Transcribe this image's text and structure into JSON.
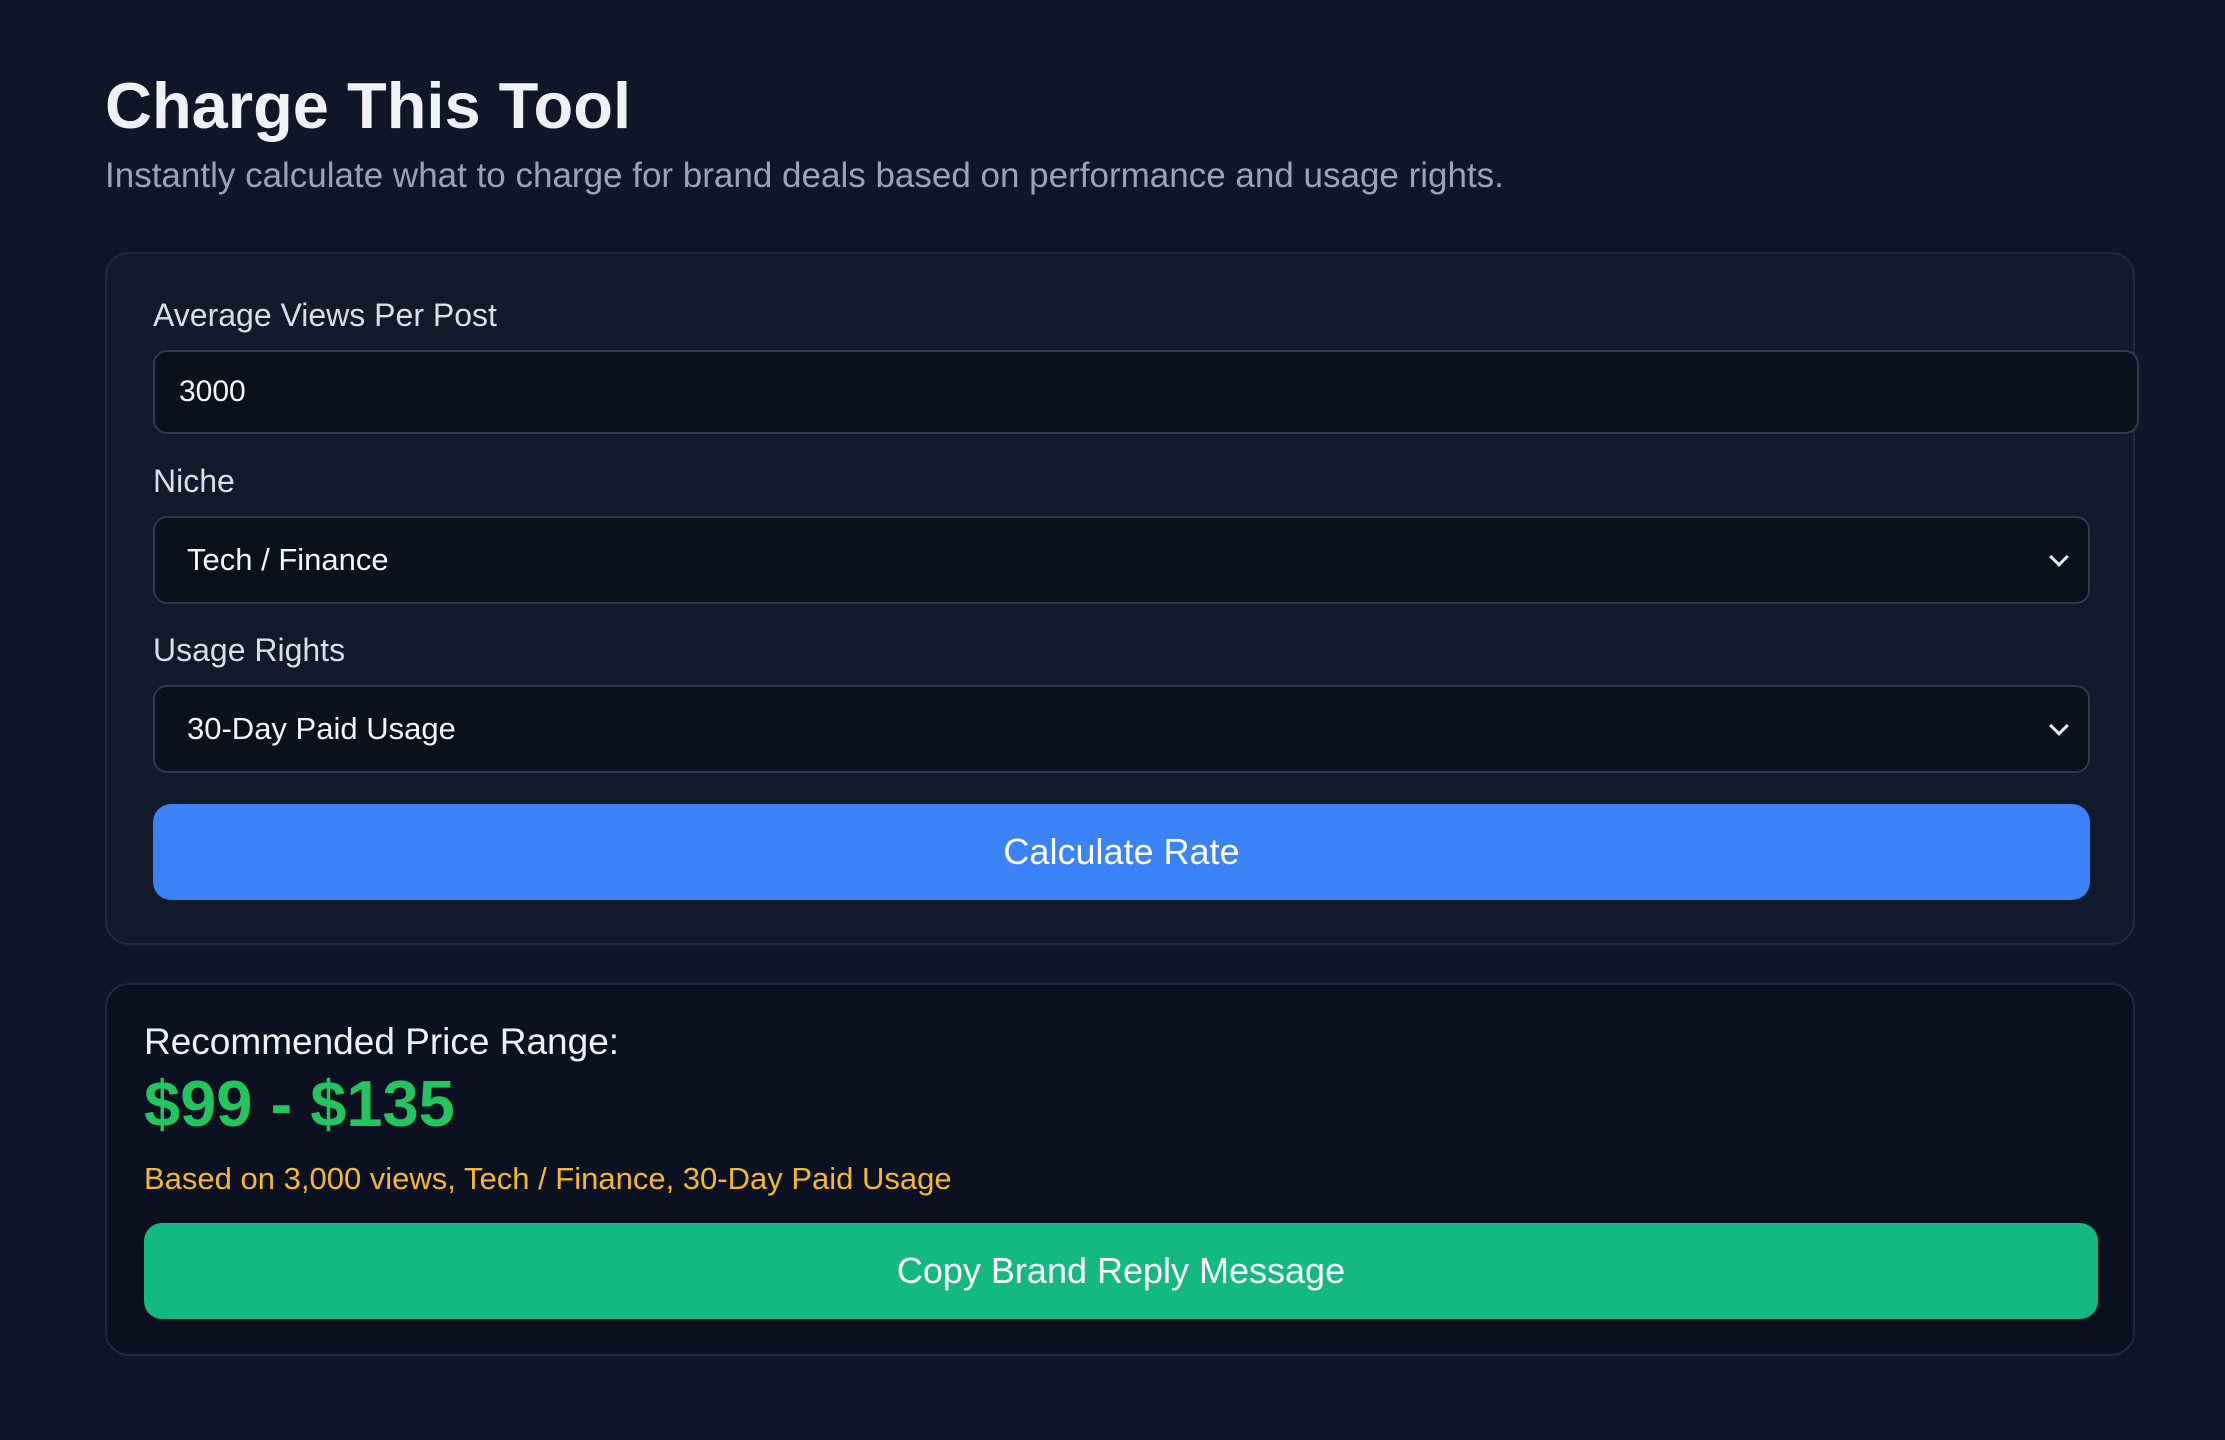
{
  "header": {
    "title": "Charge This Tool",
    "subtitle": "Instantly calculate what to charge for brand deals based on performance and usage rights."
  },
  "form": {
    "views": {
      "label": "Average Views Per Post",
      "value": "3000"
    },
    "niche": {
      "label": "Niche",
      "selected": "Tech / Finance"
    },
    "usage": {
      "label": "Usage Rights",
      "selected": "30-Day Paid Usage"
    },
    "calculate_label": "Calculate Rate"
  },
  "result": {
    "label": "Recommended Price Range:",
    "price_range": "$99 - $135",
    "basis": "Based on 3,000 views, Tech / Finance, 30-Day Paid Usage",
    "copy_label": "Copy Brand Reply Message"
  },
  "colors": {
    "background": "#0e1628",
    "primary": "#3b82f6",
    "success": "#13b981",
    "price": "#22c55e",
    "note": "#f5b82e"
  }
}
